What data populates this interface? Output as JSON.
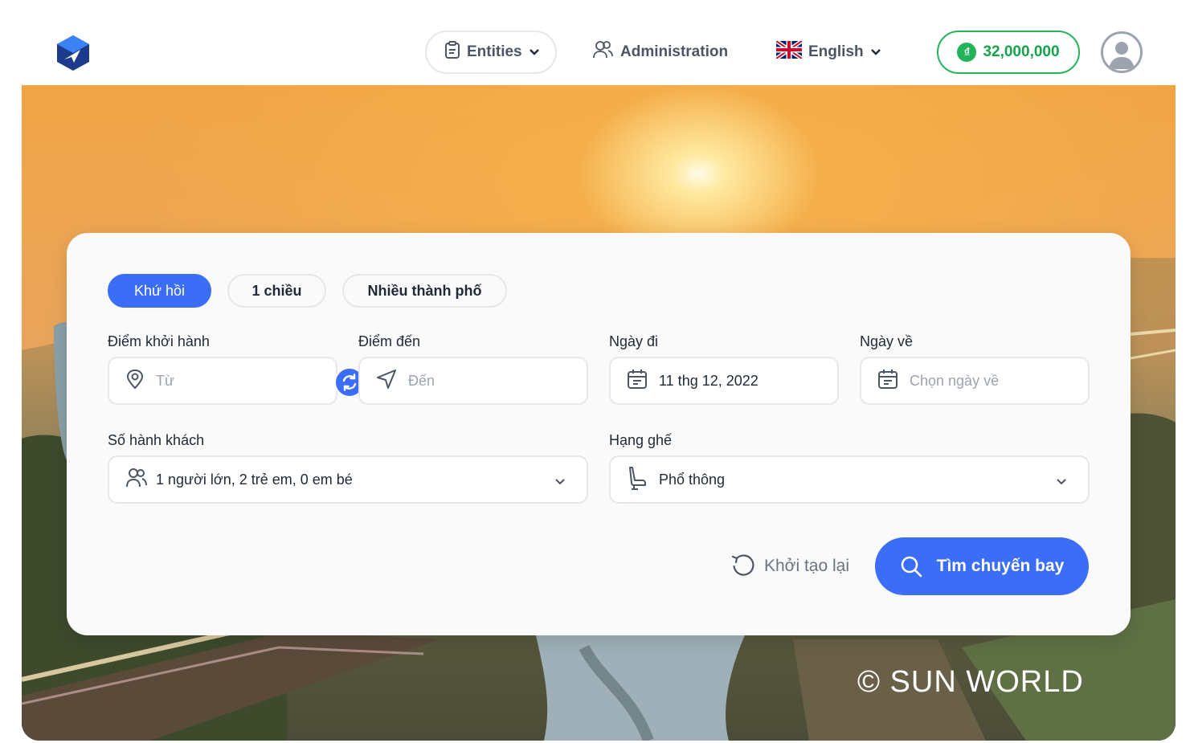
{
  "header": {
    "nav": {
      "entities_label": "Entities",
      "administration_label": "Administration",
      "language_label": "English"
    },
    "balance": {
      "currency_symbol": "₫",
      "amount": "32,000,000"
    }
  },
  "search": {
    "trip_types": [
      "Khứ hồi",
      "1 chiều",
      "Nhiều thành phố"
    ],
    "active_trip_type": "Khứ hồi",
    "origin": {
      "label": "Điểm khởi hành",
      "placeholder": "Từ"
    },
    "destination": {
      "label": "Điểm đến",
      "placeholder": "Đến"
    },
    "depart_date": {
      "label": "Ngày đi",
      "value": "11 thg 12, 2022"
    },
    "return_date": {
      "label": "Ngày về",
      "placeholder": "Chọn ngày về"
    },
    "passengers": {
      "label": "Số hành khách",
      "value": "1 người lớn, 2 trẻ em, 0 em bé"
    },
    "cabin_class": {
      "label": "Hạng ghế",
      "value": "Phổ thông"
    },
    "reset_label": "Khởi tạo lại",
    "submit_label": "Tìm chuyến bay"
  },
  "hero": {
    "watermark": "© SUN WORLD"
  },
  "colors": {
    "primary": "#3b6df6",
    "balance": "#22b45a",
    "border": "#e5e7eb"
  },
  "icons": {
    "logo": "app-logo-icon",
    "entities": "clipboard-icon",
    "administration": "users-icon",
    "language": "uk-flag-icon",
    "origin": "map-pin-icon",
    "destination": "navigation-icon",
    "swap": "swap-icon",
    "calendar": "calendar-icon",
    "passengers": "users-icon",
    "cabin": "seat-icon",
    "reset": "reset-icon",
    "search": "search-icon",
    "chevron": "chevron-down-icon"
  }
}
